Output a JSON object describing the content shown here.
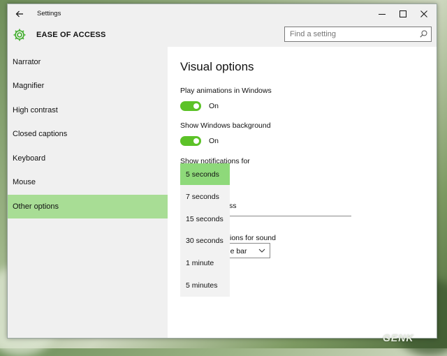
{
  "window": {
    "title": "Settings"
  },
  "header": {
    "title": "EASE OF ACCESS"
  },
  "search": {
    "placeholder": "Find a setting"
  },
  "sidebar": {
    "items": [
      {
        "label": "Narrator",
        "active": false
      },
      {
        "label": "Magnifier",
        "active": false
      },
      {
        "label": "High contrast",
        "active": false
      },
      {
        "label": "Closed captions",
        "active": false
      },
      {
        "label": "Keyboard",
        "active": false
      },
      {
        "label": "Mouse",
        "active": false
      },
      {
        "label": "Other options",
        "active": true
      }
    ]
  },
  "main": {
    "title": "Visual options",
    "animations": {
      "label": "Play animations in Windows",
      "state": "On"
    },
    "background": {
      "label": "Show Windows background",
      "state": "On"
    },
    "notifications": {
      "label": "Show notifications for",
      "options": [
        "5 seconds",
        "7 seconds",
        "15 seconds",
        "30 seconds",
        "1 minute",
        "5 minutes"
      ],
      "selected": "5 seconds"
    },
    "partial_thickness": "ss",
    "partial_sound": "ions for sound",
    "combo_value": "itle bar"
  },
  "colors": {
    "accent_toggle": "#5cc228",
    "sidebar_active": "#a8dd95",
    "dropdown_selected": "#8ed97a"
  },
  "watermark": "GENK"
}
